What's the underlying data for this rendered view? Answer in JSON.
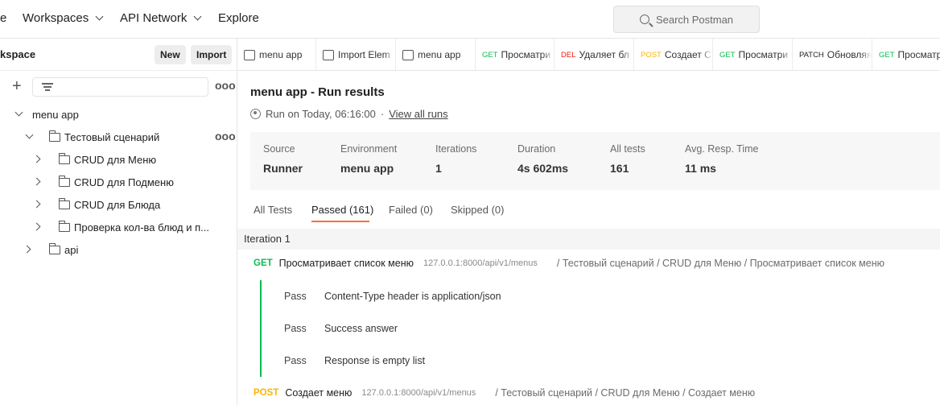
{
  "topnav": {
    "home_fragment": "e",
    "workspaces": "Workspaces",
    "api_network": "API Network",
    "explore": "Explore",
    "search_placeholder": "Search Postman"
  },
  "sidebar": {
    "workspace_name": "kspace",
    "new_label": "New",
    "import_label": "Import",
    "more": "ooo",
    "tree": [
      {
        "label": "menu app",
        "state": "expanded"
      },
      {
        "label": "Тестовый сценарий",
        "state": "expanded"
      },
      {
        "label": "CRUD для Меню",
        "state": "collapsed"
      },
      {
        "label": "CRUD для Подменю",
        "state": "collapsed"
      },
      {
        "label": "CRUD для Блюда",
        "state": "collapsed"
      },
      {
        "label": "Проверка кол-ва блюд и п...",
        "state": "collapsed"
      },
      {
        "label": "api",
        "state": "collapsed"
      }
    ]
  },
  "tabs": [
    {
      "icon": "runner-icon",
      "label": "menu app"
    },
    {
      "icon": "import-icon",
      "label": "Import Elem"
    },
    {
      "icon": "play-icon",
      "label": "menu app"
    },
    {
      "method": "GET",
      "label": "Просматри"
    },
    {
      "method": "DEL",
      "label": "Удаляет бл"
    },
    {
      "method": "POST",
      "label": "Создает С"
    },
    {
      "method": "GET",
      "label": "Просматри"
    },
    {
      "method": "PATCH",
      "label": "Обновляя"
    },
    {
      "method": "GET",
      "label": "Просматр"
    }
  ],
  "run": {
    "title": "menu app - Run results",
    "run_on": "Run on Today, 06:16:00",
    "separator": "·",
    "view_all": "View all runs",
    "stats": [
      {
        "label": "Source",
        "value": "Runner"
      },
      {
        "label": "Environment",
        "value": "menu app"
      },
      {
        "label": "Iterations",
        "value": "1"
      },
      {
        "label": "Duration",
        "value": "4s 602ms"
      },
      {
        "label": "All tests",
        "value": "161"
      },
      {
        "label": "Avg. Resp. Time",
        "value": "11 ms"
      }
    ],
    "result_tabs": [
      "All Tests",
      "Passed (161)",
      "Failed (0)",
      "Skipped (0)"
    ],
    "active_tab": "Passed (161)",
    "iteration": "Iteration 1",
    "requests": [
      {
        "method": "GET",
        "name": "Просматривает список меню",
        "url": "127.0.0.1:8000/api/v1/menus",
        "path": "/ Тестовый сценарий / CRUD для Меню / Просматривает список меню",
        "tests": [
          {
            "status": "Pass",
            "name": "Content-Type header is application/json"
          },
          {
            "status": "Pass",
            "name": "Success answer"
          },
          {
            "status": "Pass",
            "name": "Response is empty list"
          }
        ]
      },
      {
        "method": "POST",
        "name": "Создает меню",
        "url": "127.0.0.1:8000/api/v1/menus",
        "path": "/ Тестовый сценарий / CRUD для Меню / Создает меню"
      }
    ]
  },
  "colors": {
    "get": "#0cbb52",
    "post": "#ffb400",
    "del": "#eb2013",
    "accent": "#ff6c37"
  }
}
